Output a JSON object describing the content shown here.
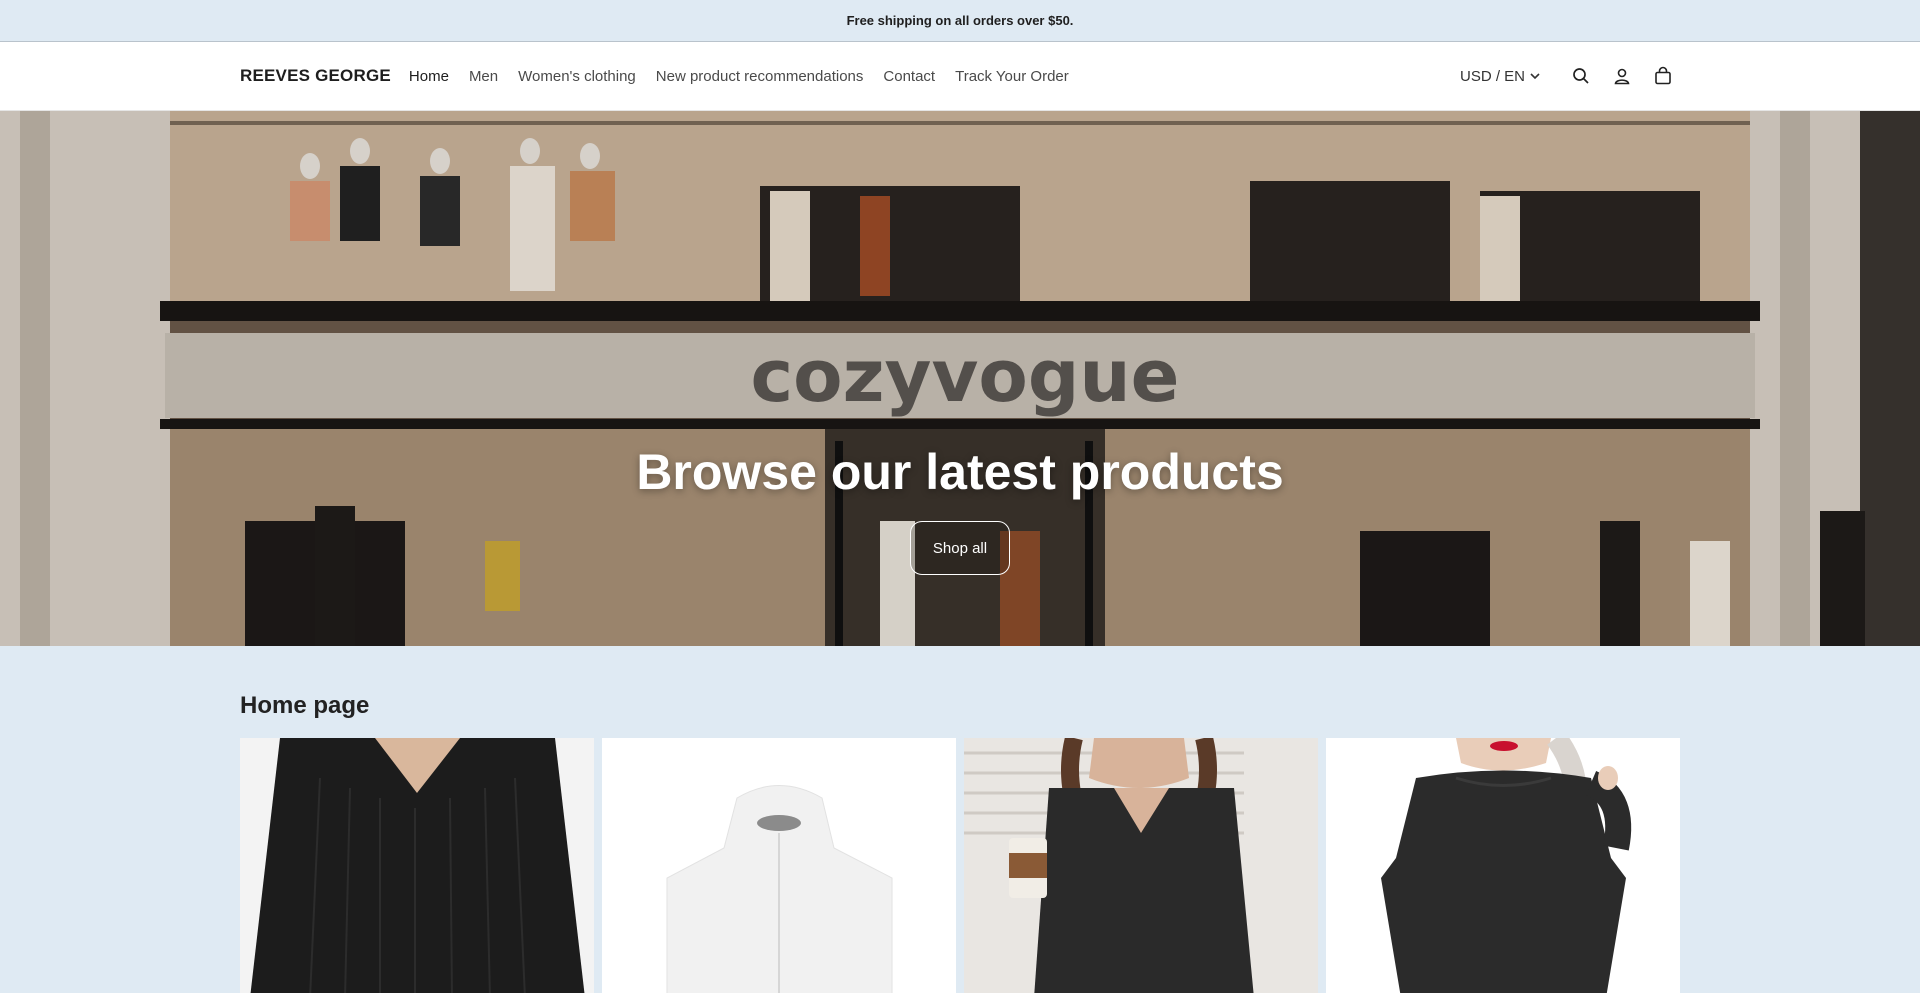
{
  "announcement": {
    "text": "Free shipping on all orders over $50."
  },
  "header": {
    "logo": "REEVES GEORGE",
    "nav": [
      {
        "label": "Home",
        "active": true
      },
      {
        "label": "Men"
      },
      {
        "label": "Women's clothing"
      },
      {
        "label": "New product recommendations"
      },
      {
        "label": "Contact"
      },
      {
        "label": "Track Your Order"
      }
    ],
    "locale": "USD / EN",
    "icons": [
      "search-icon",
      "account-icon",
      "cart-icon"
    ]
  },
  "hero": {
    "title": "Browse our latest products",
    "button": "Shop all",
    "storefront_sign": "cozyvogue"
  },
  "section": {
    "title": "Home page",
    "products": [
      {
        "image": "black ribbed v-neck sweater on male model"
      },
      {
        "image": "white zip-up hoodie"
      },
      {
        "image": "woman in black v-neck sweatshirt holding coffee"
      },
      {
        "image": "woman in black crewneck sweatshirt"
      }
    ]
  },
  "colors": {
    "background": "#dfeaf3",
    "header": "#ffffff",
    "text": "#222222"
  }
}
